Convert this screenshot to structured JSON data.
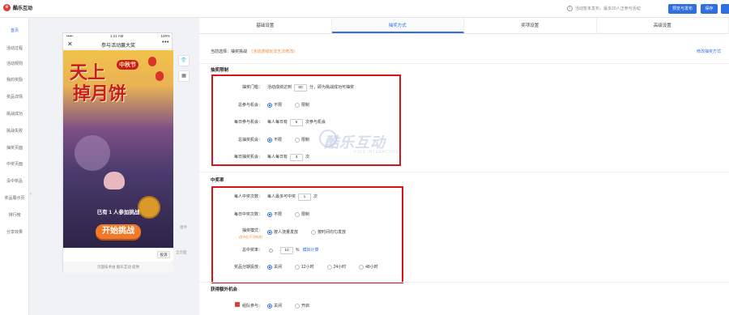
{
  "topbar": {
    "logo_letter": "e",
    "logo_text": "酷乐互动",
    "info_text": "活动暂未发布，最多20人正参与活动",
    "preview_btn": "预览与发布",
    "save_btn": "保存",
    "more_btn": ""
  },
  "nav": {
    "items": [
      "首页",
      "活动过程",
      "活动规则",
      "我的奖励",
      "奖品详情",
      "挑战成功",
      "挑战失败",
      "抽奖页面",
      "中奖页面",
      "没中奖品",
      "奖品展示页",
      "排行榜",
      "分享效果"
    ]
  },
  "phone": {
    "time": "1:21 AM",
    "battery": "100%",
    "signal": "•••••",
    "title": "参与活动赢大奖",
    "close": "✕",
    "more": "•••",
    "big_title_1": "天上",
    "big_title_2": "掉月饼",
    "tag": "中秋节",
    "join_text": "已有 1 人参加挑战",
    "start_btn": "开始挑战",
    "input_btn": "投诉",
    "footer": "页面技术由 酷乐互动 提供"
  },
  "side_tools": {
    "theme_icon": "shirt-icon",
    "apps_icon": "grid-icon",
    "link_1": "组件",
    "link_2": "全页面"
  },
  "tabs": [
    "基础设置",
    "抽奖方式",
    "奖项设置",
    "高级设置"
  ],
  "active_tab": 1,
  "mode": {
    "label": "当前选择：抽奖挑战",
    "hint": "(活动游戏玩法无法修改)",
    "link": "修改抽奖方式"
  },
  "sections": {
    "draw_limit": {
      "title": "抽奖限制",
      "threshold": {
        "label": "抽奖门槛：",
        "prefix": "活动成绩达到",
        "value": "80",
        "suffix": "分，即为挑战成功可抽奖"
      },
      "total_chances": {
        "label": "总参与机会：",
        "opt1": "不限",
        "opt2": "限制"
      },
      "daily_chances": {
        "label": "每日参与机会：",
        "prefix": "每人每日有",
        "value": "5",
        "suffix": "次参与机会"
      },
      "total_draws": {
        "label": "总抽奖机会：",
        "opt1": "不限",
        "opt2": "限制"
      },
      "daily_draws": {
        "label": "每日抽奖机会：",
        "prefix": "每人每日有",
        "value": "3",
        "suffix": "次"
      }
    },
    "winning": {
      "title": "中奖率",
      "per_user": {
        "label": "每人中奖次数：",
        "prefix": "每人最多可中奖",
        "value": "1",
        "suffix": "次"
      },
      "daily": {
        "label": "每日中奖次数：",
        "opt1": "不限",
        "opt2": "限制"
      },
      "mode": {
        "label": "抽奖模式：",
        "sub": "(发布后不可修改)",
        "opt1": "按人流量发放",
        "opt2": "按时间均匀发放"
      },
      "rate": {
        "label": "总中奖率：",
        "value": "10",
        "suffix": "%",
        "link": "模拟计算"
      },
      "schedule": {
        "label": "奖品分期投放：",
        "opts": [
          "关闭",
          "12小时",
          "24小时",
          "48小时"
        ]
      }
    },
    "extra": {
      "title": "获得额外机会",
      "team": {
        "label": "组队参与：",
        "opt1": "关闭",
        "opt2": "开启"
      }
    }
  },
  "watermark": {
    "text": "酷乐互动",
    "sub": "KULE INTERACTIVE"
  },
  "colors": {
    "accent": "#2f6fe0",
    "highlight_box": "#d8141b",
    "hint": "#f08a3c"
  }
}
